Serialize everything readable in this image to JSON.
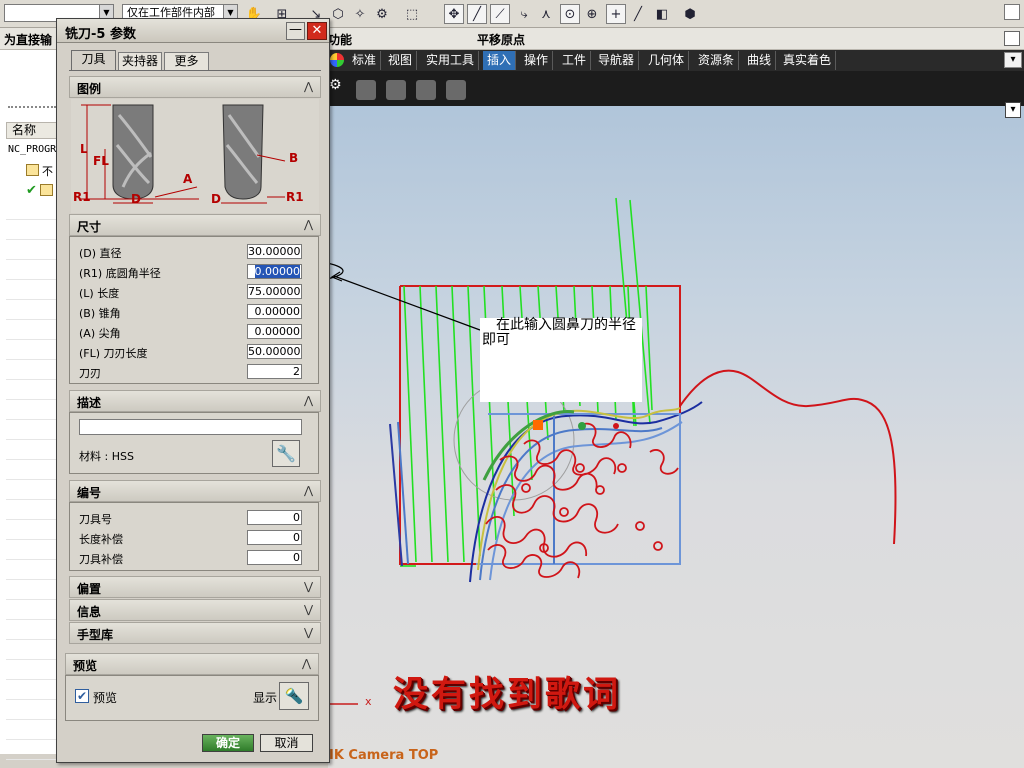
{
  "top_toolbar": {
    "filter_combo": "",
    "scope_combo": "仅在工作部件内部"
  },
  "header_row": {
    "left_title": "为直接输",
    "mid_label": "功能",
    "right_label": "平移原点"
  },
  "navigator": {
    "column_header": "名称",
    "root_item": "NC_PROGR",
    "child_item_1": "不"
  },
  "menu_bar": {
    "items": [
      "标准",
      "视图",
      "实用工具",
      "插入",
      "操作",
      "工件",
      "导航器",
      "几何体",
      "资源条",
      "曲线",
      "真实着色"
    ],
    "active_index": 3
  },
  "dialog": {
    "title": "铣刀-5 参数",
    "tabs": [
      "刀具",
      "夹持器",
      "更多"
    ],
    "active_tab": 0,
    "sections": {
      "figure": "图例",
      "dimensions": "尺寸",
      "description": "描述",
      "numbering": "编号",
      "offset": "偏置",
      "info": "信息",
      "library": "手型库",
      "preview": "预览"
    },
    "figure_labels": [
      "L",
      "FL",
      "R1",
      "D",
      "A",
      "B",
      "D",
      "R1"
    ],
    "dimensions": [
      {
        "label": "(D) 直径",
        "value": "30.00000"
      },
      {
        "label": "(R1) 底圆角半径",
        "value": "0.00000"
      },
      {
        "label": "(L) 长度",
        "value": "75.00000"
      },
      {
        "label": "(B) 锥角",
        "value": "0.00000"
      },
      {
        "label": "(A) 尖角",
        "value": "0.00000"
      },
      {
        "label": "(FL) 刀刃长度",
        "value": "50.00000"
      },
      {
        "label": "刀刃",
        "value": "2"
      }
    ],
    "description_value": "",
    "material": "材料 : HSS",
    "numbering": [
      {
        "label": "刀具号",
        "value": "0"
      },
      {
        "label": "长度补偿",
        "value": "0"
      },
      {
        "label": "刀具补偿",
        "value": "0"
      }
    ],
    "preview_checkbox": "预览",
    "preview_checked": true,
    "show_label": "显示",
    "ok": "确定",
    "cancel": "取消"
  },
  "graphics": {
    "callout": "在此输入圆鼻刀的半径即可",
    "banner": "没有找到歌词",
    "camera_label": "IK Camera TOP",
    "axis_x": "x"
  }
}
